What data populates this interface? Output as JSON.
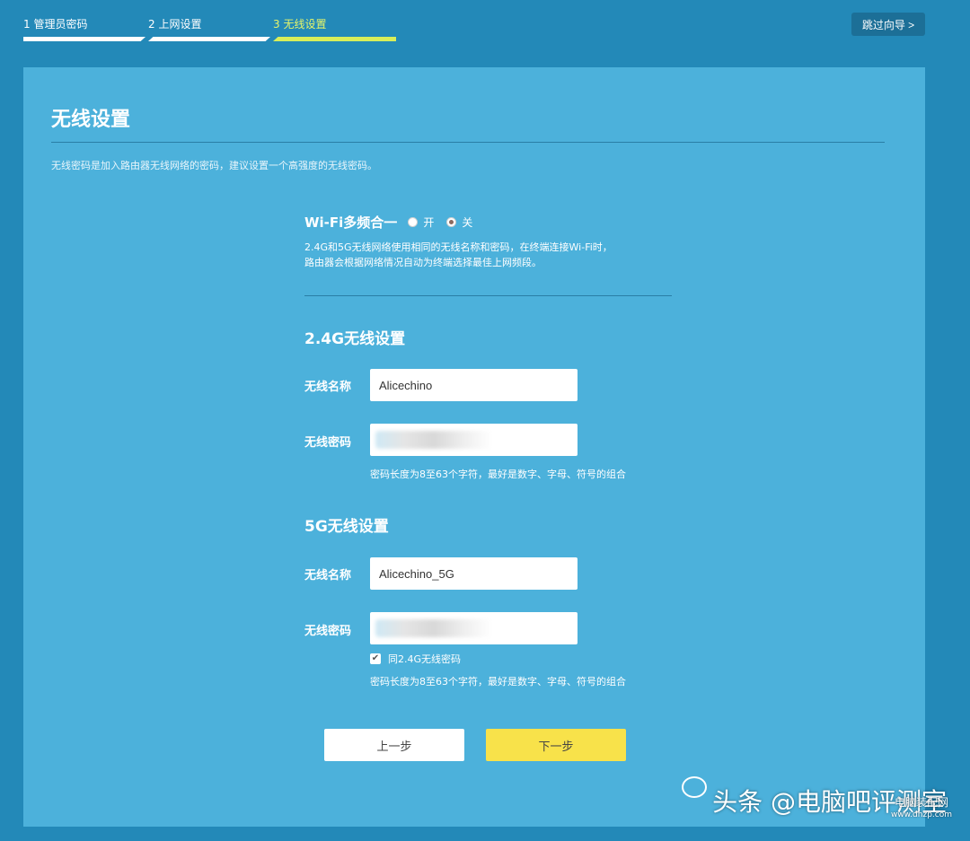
{
  "steps": [
    {
      "label": "1 管理员密码"
    },
    {
      "label": "2 上网设置"
    },
    {
      "label": "3 无线设置"
    }
  ],
  "skip_label": "跳过向导 >",
  "page_title": "无线设置",
  "intro": "无线密码是加入路由器无线网络的密码，建议设置一个高强度的无线密码。",
  "wifi_merge": {
    "label": "Wi-Fi多频合一",
    "on_label": "开",
    "off_label": "关",
    "selected": "off",
    "desc_line1": "2.4G和5G无线网络使用相同的无线名称和密码，在终端连接Wi-Fi时，",
    "desc_line2": "路由器会根据网络情况自动为终端选择最佳上网频段。"
  },
  "band24": {
    "title": "2.4G无线设置",
    "name_label": "无线名称",
    "name_value": "Alicechino",
    "pwd_label": "无线密码",
    "hint": "密码长度为8至63个字符，最好是数字、字母、符号的组合"
  },
  "band5": {
    "title": "5G无线设置",
    "name_label": "无线名称",
    "name_value": "Alicechino_5G",
    "pwd_label": "无线密码",
    "same_pwd_label": "同2.4G无线密码",
    "same_pwd_checked": true,
    "hint": "密码长度为8至63个字符，最好是数字、字母、符号的组合"
  },
  "buttons": {
    "prev": "上一步",
    "next": "下一步"
  },
  "watermark": {
    "main": "头条 @电脑吧评测室",
    "site_cn": "电脑装配网",
    "site_url": "www.dnzp.com"
  },
  "colors": {
    "background": "#2389b8",
    "panel": "#4cb1db",
    "active_step": "#d8ee5a",
    "next_button": "#f8e24a"
  }
}
